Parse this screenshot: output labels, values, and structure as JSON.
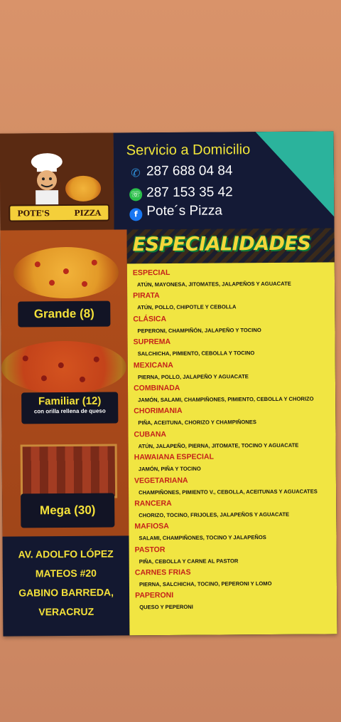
{
  "brand": {
    "logo_text_left": "POTE'S",
    "logo_text_right": "PIZZA"
  },
  "contact": {
    "title": "Servicio a Domicilio",
    "phone1": "287 688 04 84",
    "phone2": "287 153 35 42",
    "facebook": "Pote´s Pizza"
  },
  "sizes": [
    {
      "label": "Grande (8)",
      "sub": ""
    },
    {
      "label": "Familiar (12)",
      "sub": "con orilla rellena de queso"
    },
    {
      "label": "Mega (30)",
      "sub": ""
    }
  ],
  "address": [
    "AV. ADOLFO LÓPEZ",
    "MATEOS #20",
    "GABINO BARREDA,",
    "VERACRUZ"
  ],
  "specialties_title": "ESPECIALIDADES",
  "menu": [
    {
      "name": "ESPECIAL",
      "desc": "ATÚN, MAYONESA, JITOMATES, JALAPEÑOS Y AGUACATE"
    },
    {
      "name": "PIRATA",
      "desc": "ATÚN, POLLO, CHIPOTLE Y CEBOLLA"
    },
    {
      "name": "CLÁSICA",
      "desc": "PEPERONI, CHAMPIÑÓN, JALAPEÑO Y TOCINO"
    },
    {
      "name": "SUPREMA",
      "desc": "SALCHICHA, PIMIENTO, CEBOLLA Y TOCINO"
    },
    {
      "name": "MEXICANA",
      "desc": "PIERNA, POLLO, JALAPEÑO Y AGUACATE"
    },
    {
      "name": "COMBINADA",
      "desc": "JAMÓN, SALAMI, CHAMPIÑONES, PIMIENTO, CEBOLLA Y CHORIZO"
    },
    {
      "name": "CHORIMANIA",
      "desc": "PIÑA, ACEITUNA, CHORIZO Y CHAMPIÑONES"
    },
    {
      "name": "CUBANA",
      "desc": "ATÚN, JALAPEÑO, PIERNA, JITOMATE, TOCINO Y AGUACATE"
    },
    {
      "name": "HAWAIANA ESPECIAL",
      "desc": "JAMÓN, PIÑA Y TOCINO"
    },
    {
      "name": "VEGETARIANA",
      "desc": "CHAMPIÑONES, PIMIENTO V., CEBOLLA, ACEITUNAS Y AGUACATES"
    },
    {
      "name": "RANCERA",
      "desc": "CHORIZO, TOCINO, FRIJOLES, JALAPEÑOS Y AGUACATE"
    },
    {
      "name": "MAFIOSA",
      "desc": "SALAMI, CHAMPIÑONES, TOCINO Y JALAPEÑOS"
    },
    {
      "name": "PASTOR",
      "desc": "PIÑA, CEBOLLA Y CARNE AL PASTOR"
    },
    {
      "name": "CARNES FRIAS",
      "desc": "PIERNA, SALCHICHA, TOCINO, PEPERONI Y LOMO"
    },
    {
      "name": "PAPERONI",
      "desc": "QUESO Y PEPERONI"
    }
  ],
  "colors": {
    "accent_yellow": "#f4e13a",
    "menu_red": "#c4221a",
    "teal": "#2bb39c",
    "navy": "#141a36"
  }
}
